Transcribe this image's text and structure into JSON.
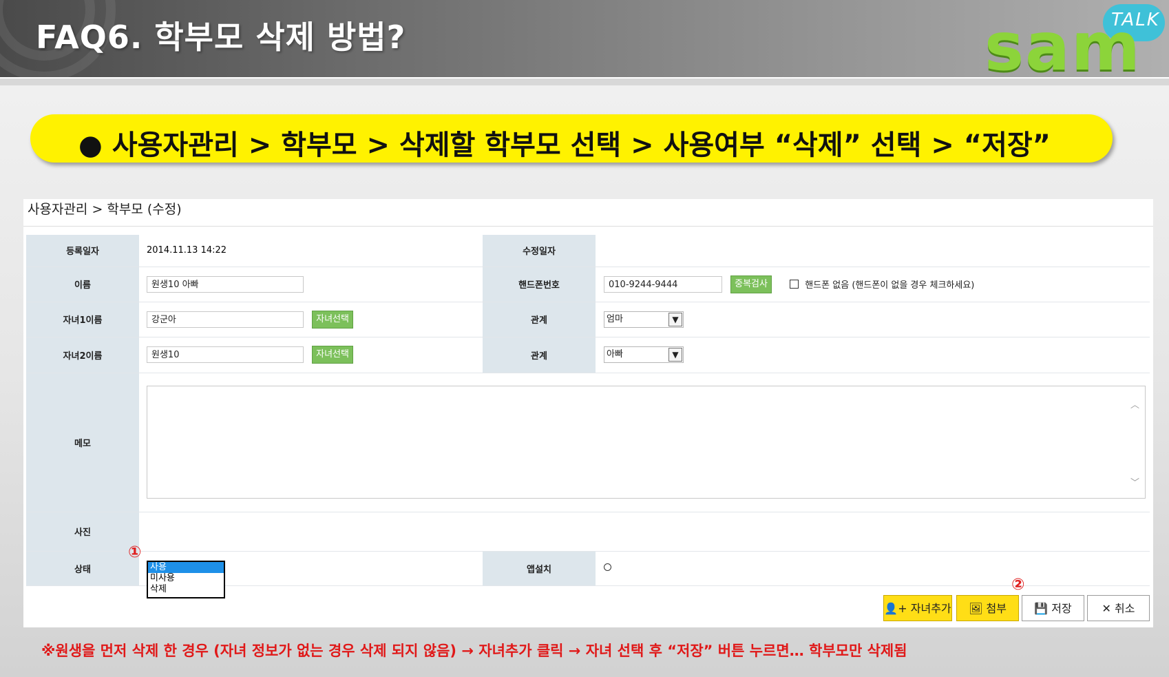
{
  "header": {
    "title": "FAQ6. 학부모 삭제 방법?",
    "logo_word": "sam",
    "logo_bubble": "TALK"
  },
  "banner": {
    "text": "● 사용자관리 > 학부모 > 삭제할 학부모 선택 > 사용여부 “삭제” 선택 > “저장”"
  },
  "breadcrumb": "사용자관리 > 학부모 (수정)",
  "form": {
    "registered_label": "등록일자",
    "registered_value": "2014.11.13 14:22",
    "modified_label": "수정일자",
    "modified_value": "",
    "name_label": "이름",
    "name_value": "원생10 아빠",
    "phone_label": "핸드폰번호",
    "phone_value": "010-9244-9444",
    "dup_check_button": "중복검사",
    "no_phone_label": "핸드폰 없음 (핸드폰이 없을 경우 체크하세요)",
    "child1_label": "자녀1이름",
    "child1_value": "강군아",
    "child_select_button": "자녀선택",
    "relation_label": "관계",
    "relation1_value": "엄마",
    "child2_label": "자녀2이름",
    "child2_value": "원생10",
    "relation2_value": "아빠",
    "memo_label": "메모",
    "photo_label": "사진",
    "status_label": "상태",
    "status_options": [
      "사용",
      "미사용",
      "삭제"
    ],
    "app_install_label": "앱설치"
  },
  "annotations": {
    "step1": "①",
    "step2": "②"
  },
  "buttons": {
    "add_child": "자녀추가",
    "attach": "첨부",
    "save": "저장",
    "cancel": "취소"
  },
  "note": "※원생을 먼저 삭제 한 경우 (자녀 정보가 없는 경우 삭제 되지 않음) → 자녀추가 클릭 → 자녀 선택 후 “저장” 버튼 누르면… 학부모만 삭제됨",
  "colors": {
    "banner": "#fff200",
    "label_bg": "#dde6ec",
    "green_button": "#7cc05b",
    "yellow_button": "#ffde16",
    "highlight": "#1e90e8",
    "annotation_red": "#e02020",
    "logo_green": "#8cd43a",
    "logo_bubble": "#3fc1d8"
  },
  "icons": {
    "add_child": "user-plus-icon",
    "attach": "image-icon",
    "save": "floppy-icon",
    "cancel": "x-icon"
  }
}
